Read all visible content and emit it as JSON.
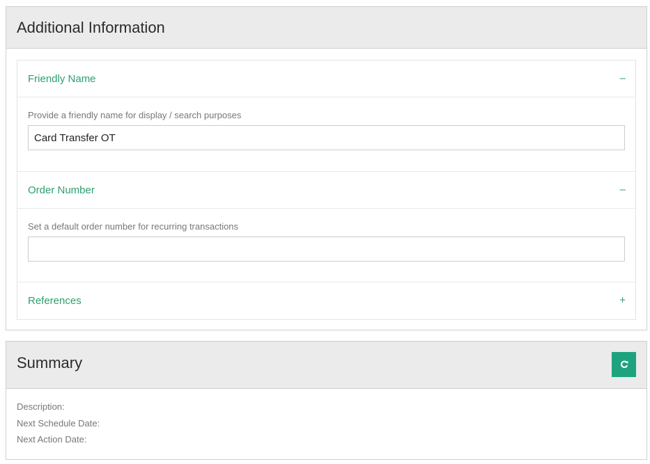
{
  "additional": {
    "title": "Additional Information",
    "sections": [
      {
        "title": "Friendly Name",
        "toggle": "–",
        "description": "Provide a friendly name for display / search purposes",
        "input_value": "Card Transfer OT"
      },
      {
        "title": "Order Number",
        "toggle": "–",
        "description": "Set a default order number for recurring transactions",
        "input_value": ""
      },
      {
        "title": "References",
        "toggle": "+"
      }
    ]
  },
  "summary": {
    "title": "Summary",
    "refresh_icon": "refresh-icon",
    "fields": [
      {
        "label": "Description:"
      },
      {
        "label": "Next Schedule Date:"
      },
      {
        "label": "Next Action Date:"
      }
    ]
  },
  "colors": {
    "accent_green": "#2e9e6e",
    "button_green": "#1fa37e",
    "header_bg": "#ebebeb"
  }
}
